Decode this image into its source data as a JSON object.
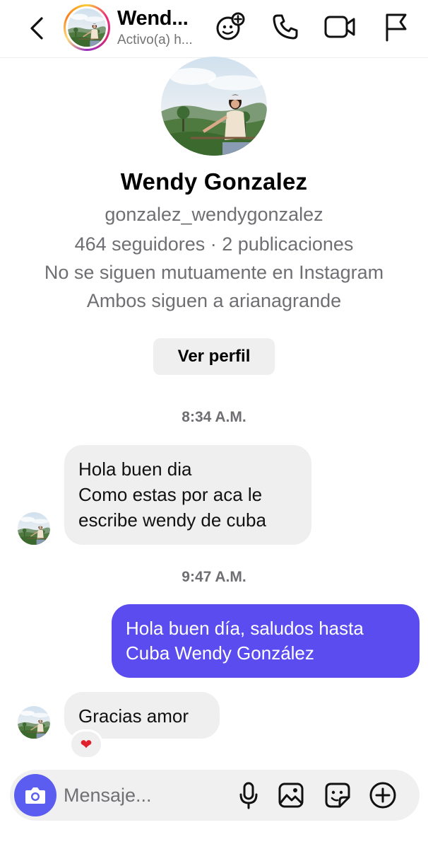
{
  "header": {
    "name": "Wend...",
    "status": "Activo(a) h..."
  },
  "profile": {
    "name": "Wendy Gonzalez",
    "username": "gonzalez_wendygonzalez",
    "stats": "464 seguidores · 2 publicaciones",
    "mutual_line": "No se siguen mutuamente en Instagram",
    "shared_line": "Ambos siguen a arianagrande",
    "view_profile_label": "Ver perfil"
  },
  "messages": {
    "time_1": "8:34 A.M.",
    "msg_1_lines": [
      "Hola buen dia",
      "Como estas por aca le",
      "escribe wendy de cuba"
    ],
    "time_2": "9:47 A.M.",
    "msg_2_lines": [
      "Hola buen día, saludos hasta",
      "Cuba Wendy González"
    ],
    "msg_3": "Gracias amor",
    "reaction": "❤"
  },
  "composer": {
    "placeholder": "Mensaje..."
  },
  "colors": {
    "outgoing_bubble": "#5b4cf0",
    "incoming_bubble": "#efeff0",
    "camera_button": "#5b5cf0",
    "secondary_text": "#6f6f73"
  },
  "icons": {
    "back": "chevron-left-icon",
    "effects": "face-effects-icon",
    "call": "phone-icon",
    "video": "video-camera-icon",
    "report": "flag-icon",
    "camera": "camera-icon",
    "mic": "microphone-icon",
    "gallery": "gallery-icon",
    "sticker": "sticker-icon",
    "more": "plus-circle-icon"
  }
}
